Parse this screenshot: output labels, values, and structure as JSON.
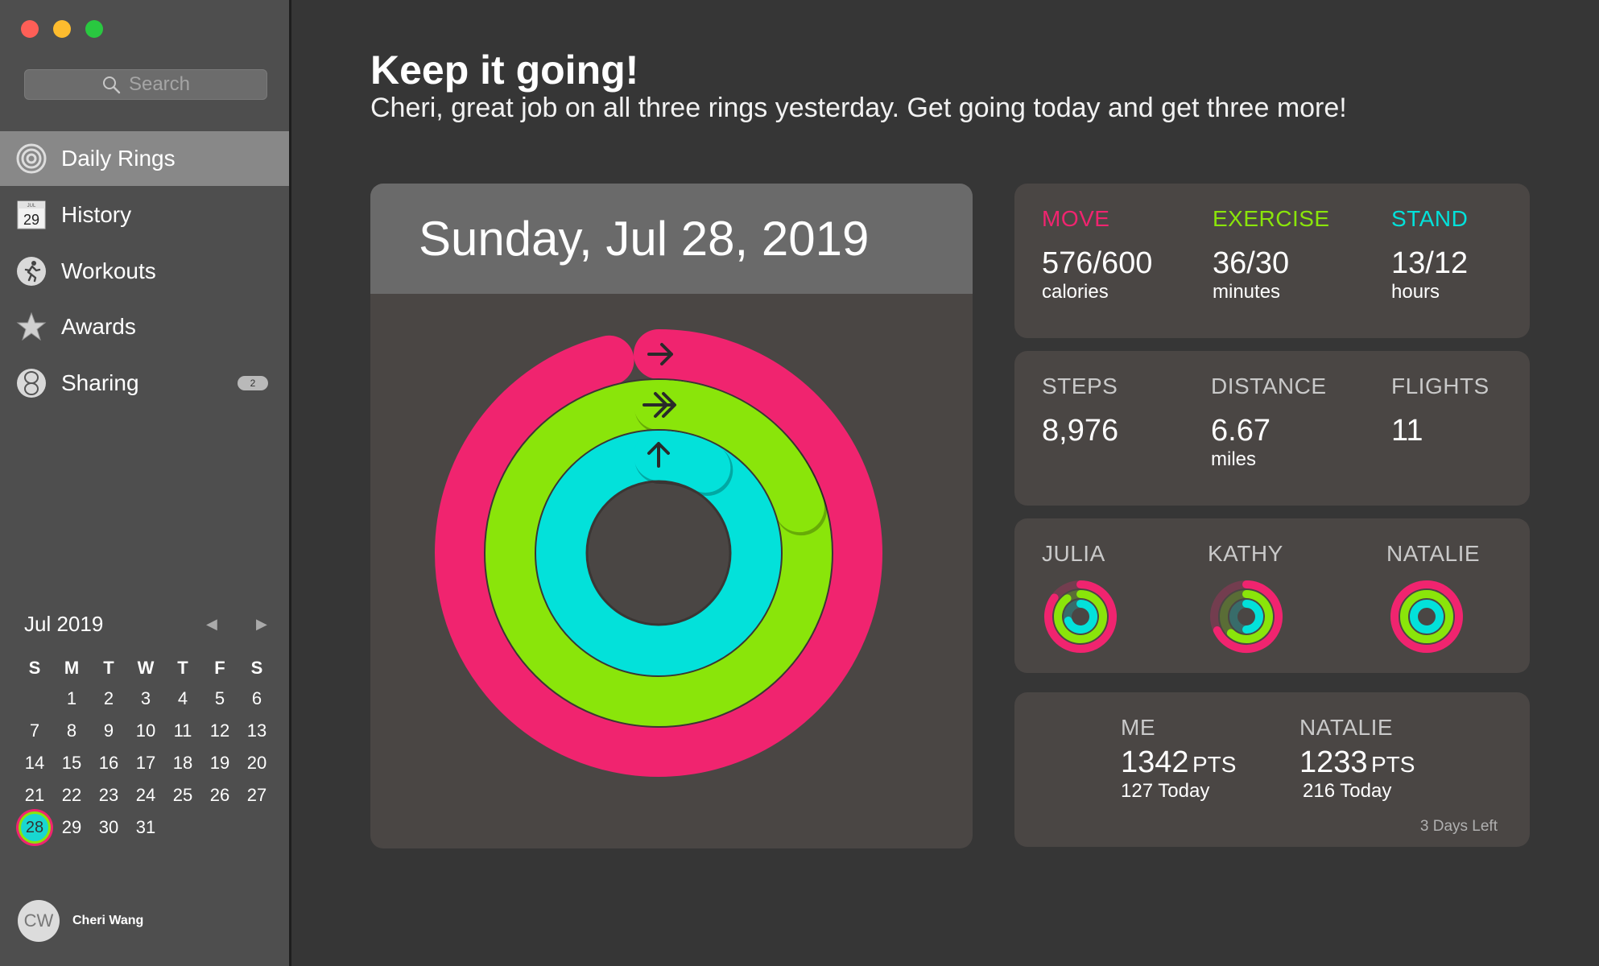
{
  "window": {
    "traffic_lights": [
      "#fe5f57",
      "#febc2e",
      "#29c840"
    ]
  },
  "sidebar": {
    "search_placeholder": "Search",
    "items": [
      {
        "label": "Daily Rings",
        "icon": "rings-icon",
        "active": true
      },
      {
        "label": "History",
        "icon": "calendar-icon",
        "icon_month": "JUL",
        "icon_day": "29"
      },
      {
        "label": "Workouts",
        "icon": "running-figure-icon"
      },
      {
        "label": "Awards",
        "icon": "star-icon"
      },
      {
        "label": "Sharing",
        "icon": "sharing-icon",
        "badge": "2"
      }
    ],
    "calendar": {
      "title": "Jul 2019",
      "weekdays": [
        "S",
        "M",
        "T",
        "W",
        "T",
        "F",
        "S"
      ],
      "days": [
        "",
        "1",
        "2",
        "3",
        "4",
        "5",
        "6",
        "7",
        "8",
        "9",
        "10",
        "11",
        "12",
        "13",
        "14",
        "15",
        "16",
        "17",
        "18",
        "19",
        "20",
        "21",
        "22",
        "23",
        "24",
        "25",
        "26",
        "27",
        "28",
        "29",
        "30",
        "31"
      ],
      "selected_day": "28"
    },
    "user": {
      "initials": "CW",
      "name": "Cheri Wang"
    }
  },
  "main": {
    "headline": "Keep it going!",
    "message": "Cheri, great job on all three rings yesterday. Get going today and get three more!",
    "date": "Sunday, Jul 28, 2019",
    "rings": {
      "move_fraction": 0.96,
      "exercise_fraction": 1.2,
      "stand_fraction": 1.08,
      "colors": {
        "move": "#f0246f",
        "exercise": "#8ae50a",
        "stand": "#03e1da"
      }
    },
    "activity": [
      {
        "label": "MOVE",
        "value": "576/600",
        "unit": "calories",
        "color": "#f0246f"
      },
      {
        "label": "EXERCISE",
        "value": "36/30",
        "unit": "minutes",
        "color": "#8ae50a"
      },
      {
        "label": "STAND",
        "value": "13/12",
        "unit": "hours",
        "color": "#03e1da"
      }
    ],
    "stats": [
      {
        "label": "STEPS",
        "value": "8,976",
        "unit": ""
      },
      {
        "label": "DISTANCE",
        "value": "6.67",
        "unit": "miles"
      },
      {
        "label": "FLIGHTS",
        "value": "11",
        "unit": ""
      }
    ],
    "friends": [
      {
        "name": "JULIA",
        "move": 0.85,
        "exercise": 0.9,
        "stand": 0.7
      },
      {
        "name": "KATHY",
        "move": 0.68,
        "exercise": 0.62,
        "stand": 0.5
      },
      {
        "name": "NATALIE",
        "move": 1.0,
        "exercise": 1.0,
        "stand": 1.0
      }
    ],
    "competition": {
      "players": [
        {
          "name": "ME",
          "points": "1342",
          "pts_label": "PTS",
          "today": "127 Today"
        },
        {
          "name": "NATALIE",
          "points": "1233",
          "pts_label": "PTS",
          "today": "216 Today"
        }
      ],
      "days_left": "3 Days Left"
    }
  }
}
